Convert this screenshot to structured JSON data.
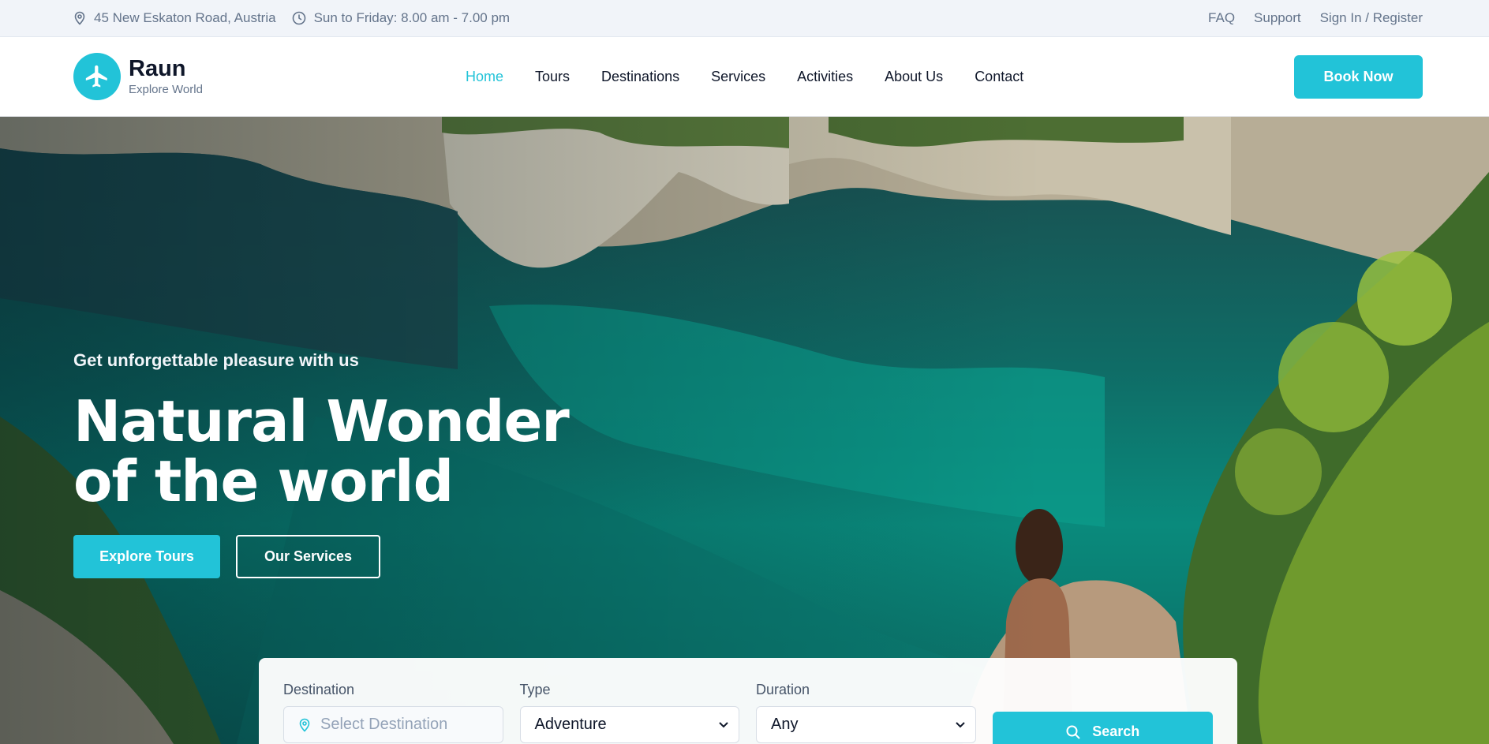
{
  "topbar": {
    "address": "45 New Eskaton Road, Austria",
    "hours": "Sun to Friday: 8.00 am - 7.00 pm",
    "links": [
      "FAQ",
      "Support",
      "Sign In / Register"
    ]
  },
  "brand": {
    "name": "Raun",
    "tagline": "Explore World"
  },
  "nav": {
    "items": [
      "Home",
      "Tours",
      "Destinations",
      "Services",
      "Activities",
      "About Us",
      "Contact"
    ],
    "active": "Home",
    "cta": "Book Now"
  },
  "hero": {
    "subtitle": "Get unforgettable pleasure with us",
    "headline_line1": "Natural Wonder",
    "headline_line2": "of the world",
    "primary_button": "Explore Tours",
    "secondary_button": "Our Services"
  },
  "search": {
    "destination_label": "Destination",
    "destination_placeholder": "Select Destination",
    "type_label": "Type",
    "type_value": "Adventure",
    "duration_label": "Duration",
    "duration_value": "Any",
    "button": "Search"
  },
  "colors": {
    "accent": "#22c3d8",
    "text_dark": "#0f172a",
    "text_muted": "#64748b"
  },
  "icons": {
    "address": "map-pin-icon",
    "hours": "clock-icon",
    "logo": "airplane-icon",
    "destination": "map-pin-icon",
    "select": "chevron-down-icon",
    "search": "search-icon"
  }
}
